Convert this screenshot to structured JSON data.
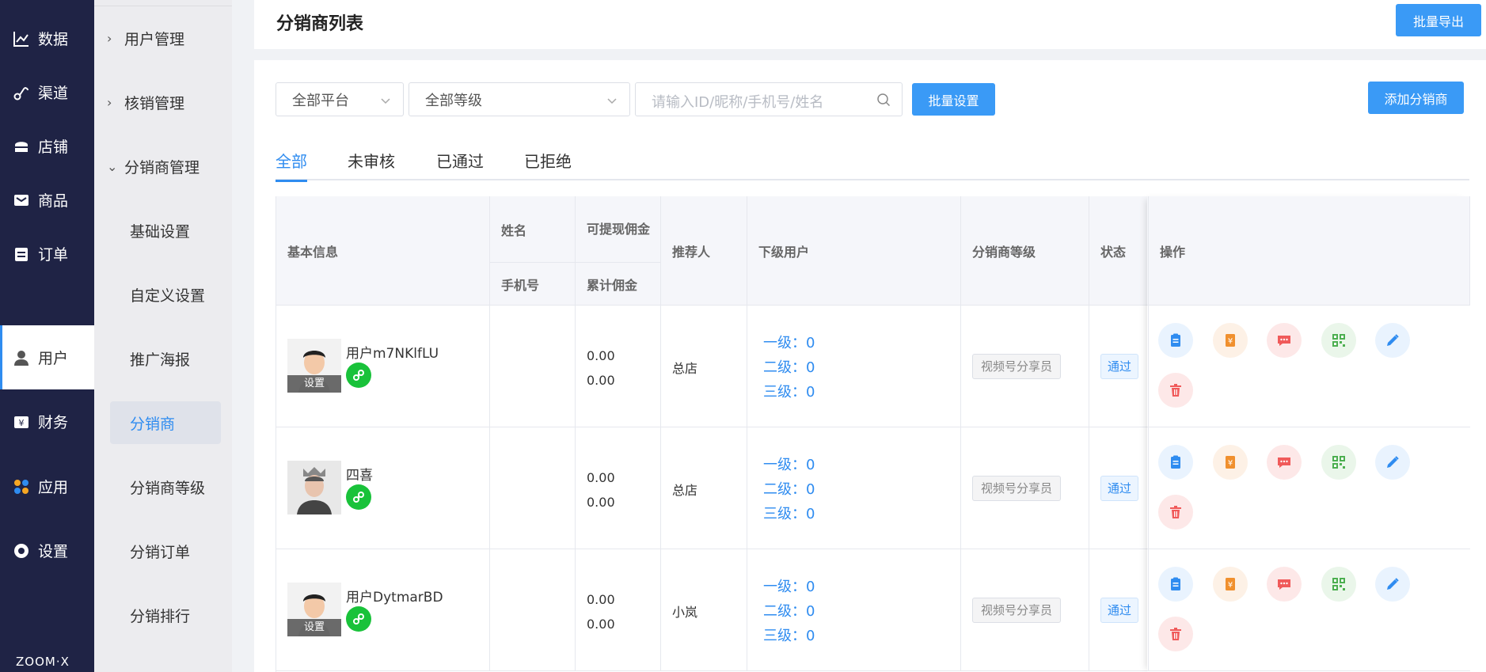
{
  "nav": {
    "items": [
      {
        "label": "数据",
        "icon": "line-chart-icon"
      },
      {
        "label": "渠道",
        "icon": "link-icon"
      },
      {
        "label": "店铺",
        "icon": "store-icon"
      },
      {
        "label": "商品",
        "icon": "goods-icon"
      },
      {
        "label": "订单",
        "icon": "order-icon"
      },
      {
        "label": "用户",
        "icon": "user-icon"
      },
      {
        "label": "财务",
        "icon": "finance-icon"
      },
      {
        "label": "应用",
        "icon": "apps-icon"
      },
      {
        "label": "设置",
        "icon": "settings-icon"
      }
    ],
    "active": "用户",
    "brand": "ZOOM·X"
  },
  "submenu": {
    "groups": [
      {
        "label": "用户管理",
        "expanded": false
      },
      {
        "label": "核销管理",
        "expanded": false
      },
      {
        "label": "分销商管理",
        "expanded": true
      }
    ],
    "items": [
      "基础设置",
      "自定义设置",
      "推广海报",
      "分销商",
      "分销商等级",
      "分销订单",
      "分销排行"
    ],
    "active": "分销商"
  },
  "header": {
    "title": "分销商列表",
    "export_label": "批量导出"
  },
  "filters": {
    "platform": "全部平台",
    "level": "全部等级",
    "search_placeholder": "请输入ID/昵称/手机号/姓名",
    "batch_label": "批量设置",
    "add_label": "添加分销商"
  },
  "tabs": [
    {
      "label": "全部",
      "active": true
    },
    {
      "label": "未审核",
      "active": false
    },
    {
      "label": "已通过",
      "active": false
    },
    {
      "label": "已拒绝",
      "active": false
    }
  ],
  "table": {
    "headers": {
      "basic": "基本信息",
      "name": "姓名",
      "phone": "手机号",
      "withdrawable": "可提现佣金",
      "total": "累计佣金",
      "referrer": "推荐人",
      "sub_users": "下级用户",
      "level": "分销商等级",
      "status": "状态",
      "ops": "操作"
    },
    "rows": [
      {
        "nickname": "用户m7NKlfLU",
        "avatar_set": "设置",
        "withdrawable": "0.00",
        "total": "0.00",
        "referrer": "总店",
        "lv1": "一级：0",
        "lv2": "二级：0",
        "lv3": "三级：0",
        "level": "视频号分享员",
        "status": "通过"
      },
      {
        "nickname": "四喜",
        "avatar_set": "",
        "withdrawable": "0.00",
        "total": "0.00",
        "referrer": "总店",
        "lv1": "一级：0",
        "lv2": "二级：0",
        "lv3": "三级：0",
        "level": "视频号分享员",
        "status": "通过"
      },
      {
        "nickname": "用户DytmarBD",
        "avatar_set": "设置",
        "withdrawable": "0.00",
        "total": "0.00",
        "referrer": "小岚",
        "lv1": "一级：0",
        "lv2": "二级：0",
        "lv3": "三级：0",
        "level": "视频号分享员",
        "status": "通过"
      }
    ],
    "actions": [
      {
        "icon": "detail-icon",
        "color": "#2f8cf0",
        "bg": "#e9f3fe"
      },
      {
        "icon": "commission-icon",
        "color": "#f0902e",
        "bg": "#fdf1e6"
      },
      {
        "icon": "message-icon",
        "color": "#f05a5a",
        "bg": "#fde8e8"
      },
      {
        "icon": "qrcode-icon",
        "color": "#4caf50",
        "bg": "#eaf6ea"
      },
      {
        "icon": "edit-icon",
        "color": "#2f8cf0",
        "bg": "#e9f3fe"
      },
      {
        "icon": "delete-icon",
        "color": "#f05a5a",
        "bg": "#fde8e8"
      }
    ]
  }
}
